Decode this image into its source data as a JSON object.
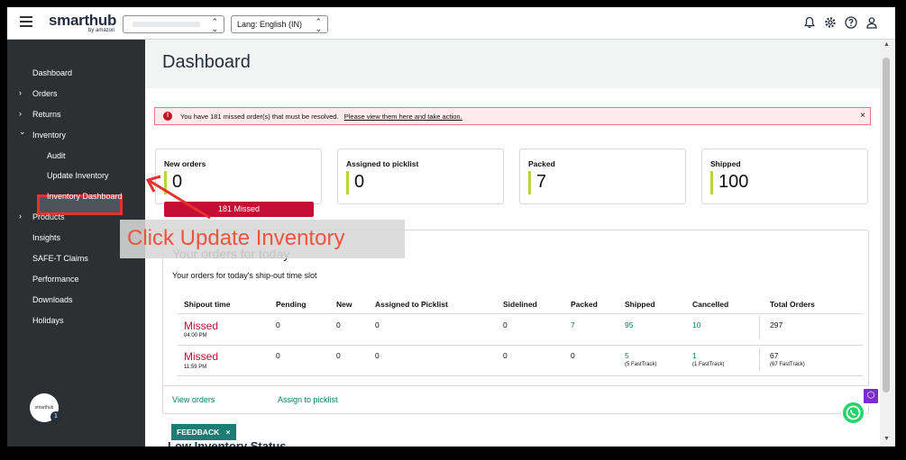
{
  "header": {
    "logo": "smarthub",
    "logo_sub": "by amazon",
    "language_select": "Lang: English (IN)"
  },
  "sidebar": {
    "items": [
      {
        "label": "Dashboard"
      },
      {
        "label": "Orders",
        "caret": "›"
      },
      {
        "label": "Returns",
        "caret": "›"
      },
      {
        "label": "Inventory",
        "caret": "⌄"
      },
      {
        "label": "Audit"
      },
      {
        "label": "Update Inventory"
      },
      {
        "label": "Inventory Dashboard"
      },
      {
        "label": "Products",
        "caret": "›"
      },
      {
        "label": "Insights"
      },
      {
        "label": "SAFE-T Claims"
      },
      {
        "label": "Performance"
      },
      {
        "label": "Downloads"
      },
      {
        "label": "Holidays"
      }
    ],
    "avatar_text": "smarthub",
    "avatar_badge": "1"
  },
  "main": {
    "title": "Dashboard",
    "alert": {
      "text": "You have 181 missed order(s) that must be resolved.",
      "link": "Please view them here and take action.",
      "icon": "!",
      "close": "×"
    },
    "stats": [
      {
        "label": "New orders",
        "value": "0"
      },
      {
        "label": "Assigned to picklist",
        "value": "0"
      },
      {
        "label": "Packed",
        "value": "7"
      },
      {
        "label": "Shipped",
        "value": "100"
      }
    ],
    "missed_button": "181 Missed",
    "orders": {
      "title": "Your orders for today",
      "subtitle": "Your orders for today's ship-out time slot",
      "columns": [
        "Shipout time",
        "Pending",
        "New",
        "Assigned to Picklist",
        "Sidelined",
        "Packed",
        "Shipped",
        "Cancelled",
        "Total Orders"
      ],
      "rows": [
        {
          "status": "Missed",
          "time": "04:00 PM",
          "pending": "0",
          "new": "0",
          "assigned": "0",
          "sidelined": "0",
          "packed": "7",
          "shipped": "95",
          "shipped_note": "",
          "cancelled": "10",
          "cancelled_note": "",
          "total": "297",
          "total_note": ""
        },
        {
          "status": "Missed",
          "time": "11:59 PM",
          "pending": "0",
          "new": "0",
          "assigned": "0",
          "sidelined": "0",
          "packed": "0",
          "shipped": "5",
          "shipped_note": "(5 FastTrack)",
          "cancelled": "1",
          "cancelled_note": "(1 FastTrack)",
          "total": "67",
          "total_note": "(67 FastTrack)"
        }
      ],
      "view_orders": "View orders",
      "assign_picklist": "Assign to picklist"
    },
    "feedback": "FEEDBACK",
    "feedback_close": "×",
    "low_inventory_title": "Low Inventory Status"
  },
  "annotation": {
    "text": "Click Update Inventory"
  },
  "icons": [
    "menu-icon",
    "bell-icon",
    "gear-icon",
    "help-icon",
    "user-icon",
    "alert-icon",
    "whatsapp-icon"
  ],
  "colors": {
    "missed_red": "#c40e33",
    "teal": "#067d62",
    "sidebar_bg": "#2d3033",
    "stat_bar": "#b7d63c",
    "annotation_red": "#e5322d"
  }
}
